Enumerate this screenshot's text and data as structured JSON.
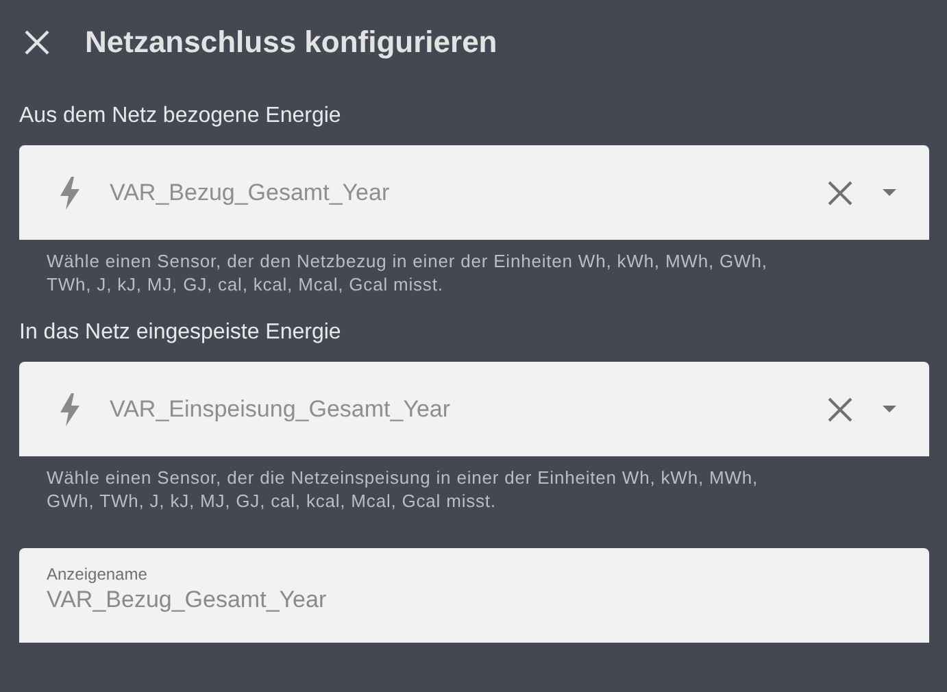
{
  "dialog": {
    "title": "Netzanschluss konfigurieren"
  },
  "sections": [
    {
      "label": "Aus dem Netz bezogene Energie",
      "sensor": {
        "value": "VAR_Bezug_Gesamt_Year",
        "disabled": true
      },
      "helper": "Wähle einen Sensor, der den Netzbezug in einer der Einheiten Wh, kWh, MWh, GWh, TWh, J, kJ, MJ, GJ, cal, kcal, Mcal, Gcal misst."
    },
    {
      "label": "In das Netz eingespeiste Energie",
      "sensor": {
        "value": "VAR_Einspeisung_Gesamt_Year",
        "disabled": true
      },
      "helper": "Wähle einen Sensor, der die Netzeinspeisung in einer der Einheiten Wh, kWh, MWh, GWh, TWh, J, kJ, MJ, GJ, cal, kcal, Mcal, Gcal misst."
    }
  ],
  "name_field": {
    "label": "Anzeigename",
    "value": "VAR_Bezug_Gesamt_Year"
  }
}
